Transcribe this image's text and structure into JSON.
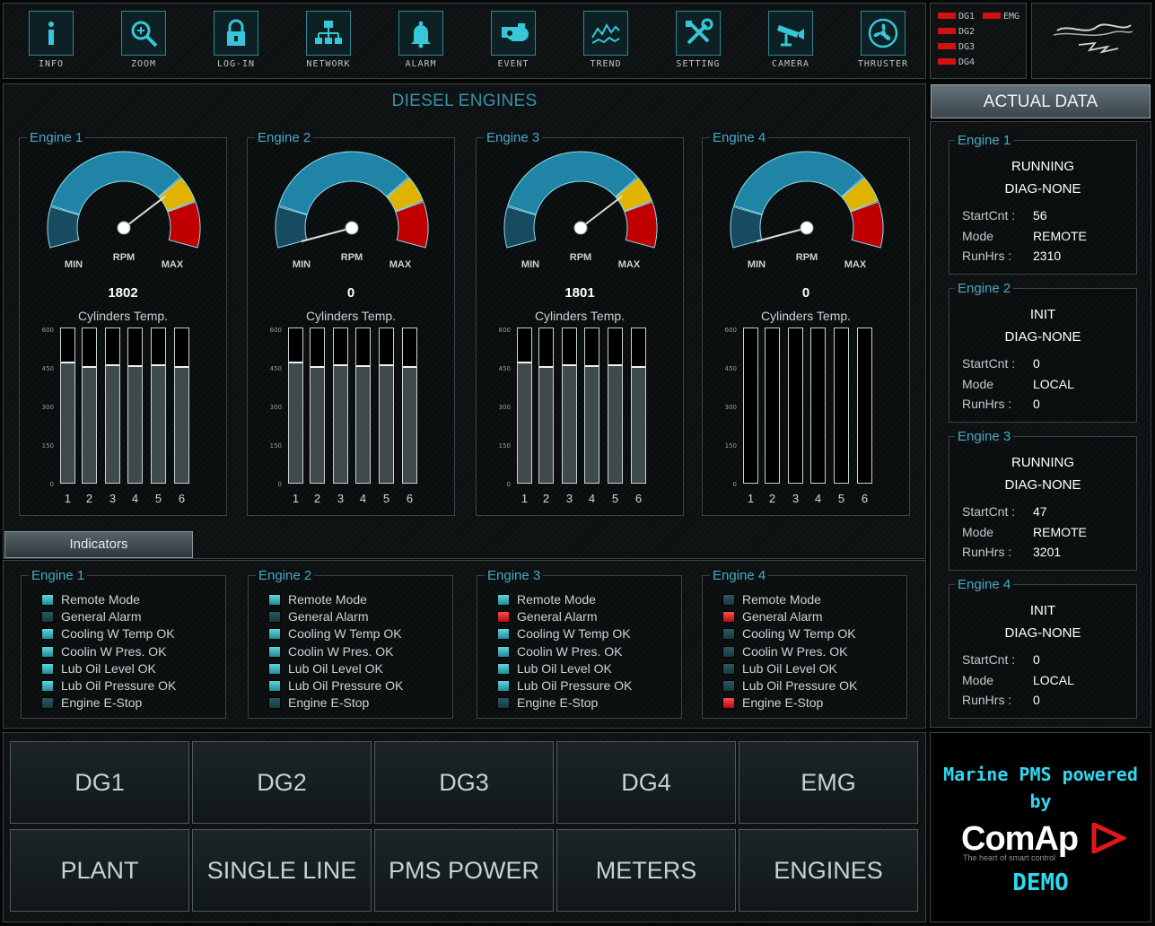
{
  "toolbar": {
    "items": [
      {
        "label": "INFO",
        "icon": "info-icon"
      },
      {
        "label": "ZOOM",
        "icon": "zoom-icon"
      },
      {
        "label": "LOG-IN",
        "icon": "lock-icon"
      },
      {
        "label": "NETWORK",
        "icon": "network-icon"
      },
      {
        "label": "ALARM",
        "icon": "bell-icon"
      },
      {
        "label": "EVENT",
        "icon": "event-icon"
      },
      {
        "label": "TREND",
        "icon": "trend-icon"
      },
      {
        "label": "SETTING",
        "icon": "tools-icon"
      },
      {
        "label": "CAMERA",
        "icon": "camera-icon"
      },
      {
        "label": "THRUSTER",
        "icon": "fan-icon"
      }
    ]
  },
  "dg_status": {
    "items": [
      "DG1",
      "EMG",
      "DG2",
      "DG3",
      "DG4"
    ],
    "led_color": "#d01212"
  },
  "diesel": {
    "title": "DIESEL ENGINES",
    "gauge_labels": {
      "min": "MIN",
      "rpm": "RPM",
      "max": "MAX"
    },
    "cyl_title": "Cylinders Temp.",
    "y_ticks": [
      "600",
      "450",
      "300",
      "150",
      "0"
    ],
    "y_max": 600,
    "rpm_max": 2400,
    "cyl_numbers": [
      "1",
      "2",
      "3",
      "4",
      "5",
      "6"
    ],
    "engines": [
      {
        "name": "Engine 1",
        "rpm": "1802",
        "rpm_value": 1802,
        "cyl_temps": [
          470,
          455,
          460,
          458,
          460,
          455
        ]
      },
      {
        "name": "Engine 2",
        "rpm": "0",
        "rpm_value": 0,
        "cyl_temps": [
          470,
          455,
          460,
          458,
          460,
          455
        ]
      },
      {
        "name": "Engine 3",
        "rpm": "1801",
        "rpm_value": 1801,
        "cyl_temps": [
          470,
          455,
          460,
          458,
          460,
          455
        ]
      },
      {
        "name": "Engine 4",
        "rpm": "0",
        "rpm_value": 0,
        "cyl_temps": [
          0,
          0,
          0,
          0,
          0,
          0
        ]
      }
    ]
  },
  "indicators": {
    "tab_label": "Indicators",
    "row_labels": [
      "Remote Mode",
      "General Alarm",
      "Cooling W Temp OK",
      "Coolin W Pres. OK",
      "Lub Oil Level OK",
      "Lub Oil Pressure OK",
      "Engine E-Stop"
    ],
    "engines": [
      {
        "name": "Engine 1",
        "states": [
          "on",
          "off",
          "on",
          "on",
          "on",
          "on",
          "off"
        ]
      },
      {
        "name": "Engine 2",
        "states": [
          "on",
          "off",
          "on",
          "on",
          "on",
          "on",
          "off"
        ]
      },
      {
        "name": "Engine 3",
        "states": [
          "on",
          "alarm",
          "on",
          "on",
          "on",
          "on",
          "off"
        ]
      },
      {
        "name": "Engine 4",
        "states": [
          "off",
          "alarm",
          "off",
          "off",
          "off",
          "off",
          "alarm"
        ]
      }
    ]
  },
  "actual_data": {
    "title": "ACTUAL DATA",
    "keys": {
      "startcnt": "StartCnt :",
      "mode": "Mode",
      "runhrs": "RunHrs :"
    },
    "engines": [
      {
        "name": "Engine 1",
        "state": "RUNNING",
        "diag": "DIAG-NONE",
        "startcnt": "56",
        "mode": "REMOTE",
        "runhrs": "2310"
      },
      {
        "name": "Engine 2",
        "state": "INIT",
        "diag": "DIAG-NONE",
        "startcnt": "0",
        "mode": "LOCAL",
        "runhrs": "0"
      },
      {
        "name": "Engine 3",
        "state": "RUNNING",
        "diag": "DIAG-NONE",
        "startcnt": "47",
        "mode": "REMOTE",
        "runhrs": "3201"
      },
      {
        "name": "Engine 4",
        "state": "INIT",
        "diag": "DIAG-NONE",
        "startcnt": "0",
        "mode": "LOCAL",
        "runhrs": "0"
      }
    ]
  },
  "nav": {
    "buttons": [
      "DG1",
      "DG2",
      "DG3",
      "DG4",
      "EMG",
      "PLANT",
      "SINGLE LINE",
      "PMS POWER",
      "METERS",
      "ENGINES"
    ]
  },
  "brand": {
    "line1": "Marine PMS powered",
    "line2": "by",
    "logo": "ComAp",
    "tagline": "The heart of smart control",
    "demo": "DEMO"
  },
  "colors": {
    "accent": "#2fd8f0",
    "gauge_blue": "#1d7f9e",
    "gauge_yellow": "#e0b300",
    "gauge_red": "#c00000"
  }
}
